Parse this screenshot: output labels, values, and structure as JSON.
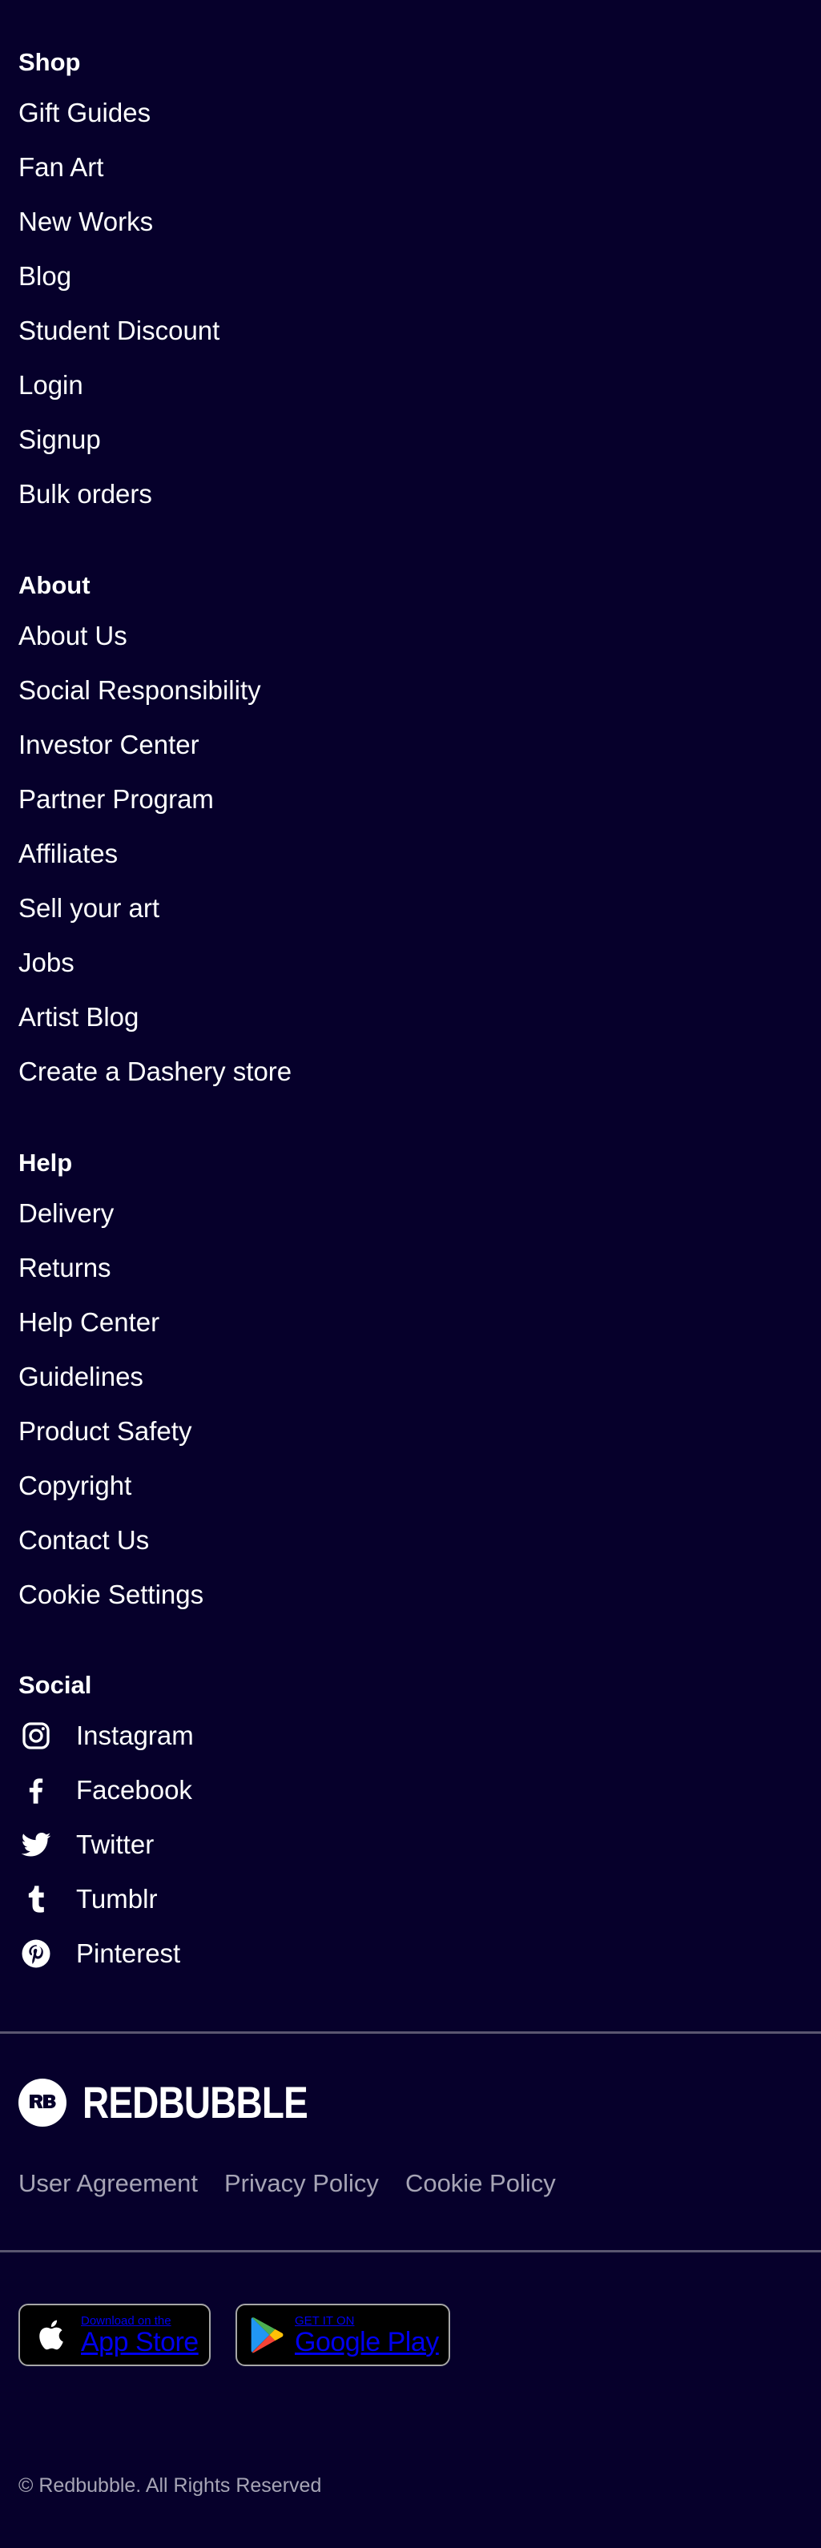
{
  "sections": {
    "shop": {
      "title": "Shop",
      "links": [
        "Gift Guides",
        "Fan Art",
        "New Works",
        "Blog",
        "Student Discount",
        "Login",
        "Signup",
        "Bulk orders"
      ]
    },
    "about": {
      "title": "About",
      "links": [
        "About Us",
        "Social Responsibility",
        "Investor Center",
        "Partner Program",
        "Affiliates",
        "Sell your art",
        "Jobs",
        "Artist Blog",
        "Create a Dashery store"
      ]
    },
    "help": {
      "title": "Help",
      "links": [
        "Delivery",
        "Returns",
        "Help Center",
        "Guidelines",
        "Product Safety",
        "Copyright",
        "Contact Us",
        "Cookie Settings"
      ]
    },
    "social": {
      "title": "Social",
      "links": [
        {
          "label": "Instagram",
          "icon": "instagram-icon"
        },
        {
          "label": "Facebook",
          "icon": "facebook-icon"
        },
        {
          "label": "Twitter",
          "icon": "twitter-icon"
        },
        {
          "label": "Tumblr",
          "icon": "tumblr-icon"
        },
        {
          "label": "Pinterest",
          "icon": "pinterest-icon"
        }
      ]
    }
  },
  "brand": {
    "name": "REDBUBBLE",
    "mark": "RB",
    "icon": "redbubble-logo-icon"
  },
  "legal": [
    "User Agreement",
    "Privacy Policy",
    "Cookie Policy"
  ],
  "app_badges": {
    "app_store": {
      "small": "Download on the",
      "big": "App Store",
      "icon": "apple-icon"
    },
    "google_play": {
      "small": "GET IT ON",
      "big": "Google Play",
      "icon": "google-play-icon"
    }
  },
  "copyright": "© Redbubble. All Rights Reserved",
  "colors": {
    "background": "#06002b",
    "text": "#ffffff",
    "muted": "#a6a4b5",
    "divider": "#5a5670"
  }
}
